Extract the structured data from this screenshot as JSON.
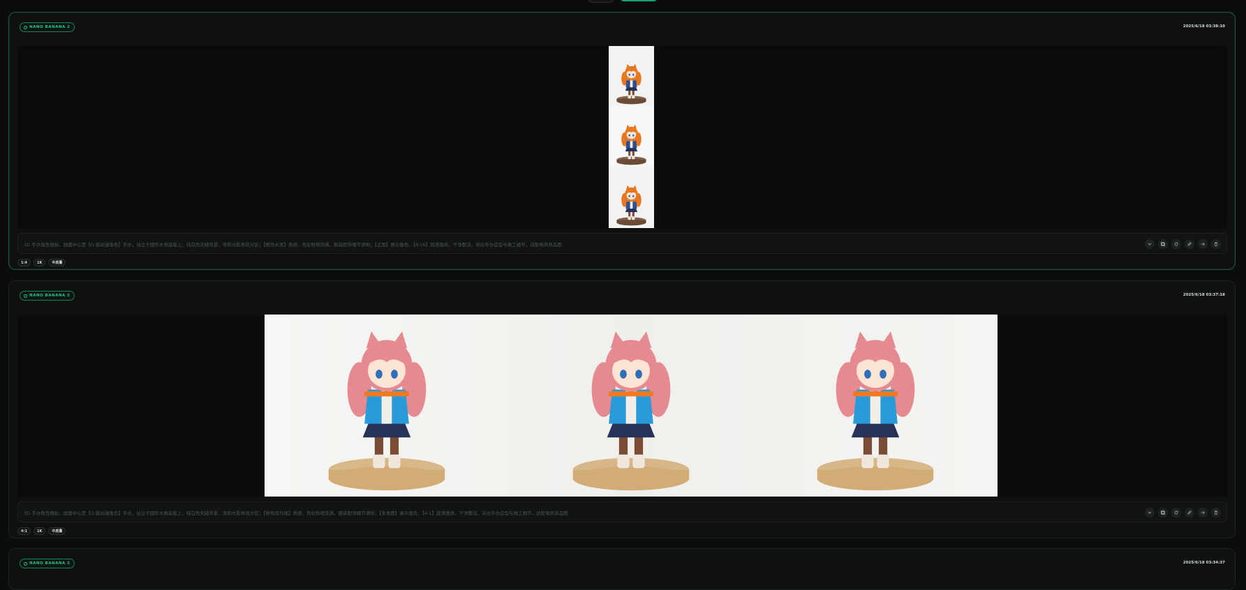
{
  "top_controls": [
    "",
    ""
  ],
  "cards": [
    {
      "model": "NANO BANANA 2",
      "timestamp": "2025/6/18 03:38:10",
      "prompt": "3D 手办角色摆拍，画面中心是【Q 版动漫角色】手办，站立于圆形木质底座上；纯白色无缝背景，柔和光影表现分区；【橙色长发】质感，色彩鲜艳饱满，服装配饰细节清晰；【正面】展示角色，【9:16】超清画质，干净整洁，突出手办造型与做工细节，适配电商商品图",
      "tags": [
        "1:4",
        "1K",
        "中质量"
      ],
      "layout": "vertical",
      "hair": "#e8781f",
      "outfit": "#2f4f8f"
    },
    {
      "model": "NANO BANANA 2",
      "timestamp": "2025/6/18 03:37:18",
      "prompt": "3D 手办角色摆拍，画面中心是【Q 版动漫角色】手办，站立于圆形木质底座上；纯白色无缝背景，柔和光影表现分区；【粉色双马尾】质感，色彩鲜艳饱满，服装配饰细节清晰；【多角度】展示角色，【4:1】超清画质，干净整洁，突出手办造型与做工细节，适配电商商品图",
      "tags": [
        "4:1",
        "1K",
        "中质量"
      ],
      "layout": "horizontal",
      "hair": "#e68a92",
      "outfit": "#2a9ad8"
    },
    {
      "model": "NANO BANANA 2",
      "timestamp": "2025/6/18 03:34:37"
    }
  ],
  "actions": [
    "chevron-down-icon",
    "copy-icon",
    "refresh-icon",
    "edit-icon",
    "arrow-right-icon",
    "trash-icon"
  ],
  "colors": {
    "accent": "#22c58b",
    "active_border": "#1a5a42",
    "background": "#0b0c0c"
  }
}
